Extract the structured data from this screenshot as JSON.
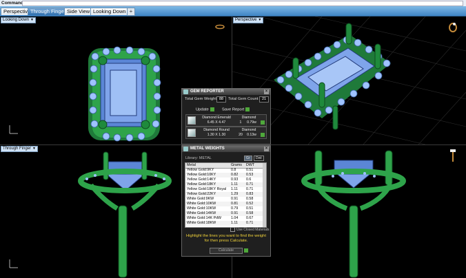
{
  "command": {
    "label": "Command:"
  },
  "tabs": [
    "Perspective",
    "Through Finger",
    "Side View",
    "Looking Down"
  ],
  "tab_add": "+",
  "viewports": {
    "top_left": "Looking Down",
    "top_right": "Perspective",
    "bottom_left": "Through Finger"
  },
  "gem_reporter": {
    "title": "GEM REPORTER",
    "total_weight_label": "Total Gem Weight",
    "total_weight_value": "88",
    "total_count_label": "Total Gem Count",
    "total_count_value": "21",
    "update_label": "Update",
    "save_label": "Save Report",
    "gems": [
      {
        "name": "Diamond Emerald",
        "size": "6.45 X 4.47",
        "material": "Diamond",
        "count": "1",
        "weight": "0.79w"
      },
      {
        "name": "Diamond Round",
        "size": "1.30 X 1.30",
        "material": "Diamond",
        "count": "20",
        "weight": "0.13w"
      }
    ]
  },
  "metal_weights": {
    "title": "METAL WEIGHTS",
    "library_label": "Library: METAL",
    "unit_gr": "Gr",
    "unit_dwt": "Dwt",
    "columns": [
      "Metal",
      "Grams",
      "DWT"
    ],
    "rows": [
      [
        "Yellow Gold:9KY",
        "0.8",
        "0.51"
      ],
      [
        "Yellow Gold:10KY",
        "0.82",
        "0.53"
      ],
      [
        "Yellow Gold:14KY",
        "0.93",
        "0.6"
      ],
      [
        "Yellow Gold:18KY",
        "1.11",
        "0.71"
      ],
      [
        "Yellow Gold:18KY Royal",
        "1.11",
        "0.71"
      ],
      [
        "Yellow Gold:22KY",
        "1.29",
        "0.83"
      ],
      [
        "White Gold:9KW",
        "0.91",
        "0.58"
      ],
      [
        "White Gold:10KW",
        "0.81",
        "0.52"
      ],
      [
        "White Gold:10KW",
        "0.79",
        "0.51"
      ],
      [
        "White Gold:14KW",
        "0.91",
        "0.58"
      ],
      [
        "White Gold:14K PdW",
        "1.04",
        "0.67"
      ],
      [
        "White Gold:18KW",
        "1.11",
        "0.71"
      ]
    ],
    "use_closed_label": "Use Closed Materials",
    "hint": "Highlight the lines you want to find the weight for then press Calculate.",
    "calculate_label": "Calculate"
  }
}
